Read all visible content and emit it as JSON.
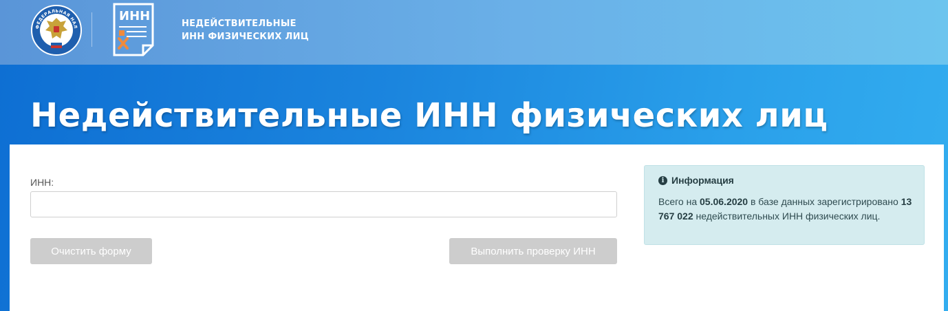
{
  "header": {
    "brand_line1": "НЕДЕЙСТВИТЕЛЬНЫЕ",
    "brand_line2": "ИНН ФИЗИЧЕСКИХ ЛИЦ",
    "emblem_text": "ФЕДЕРАЛЬНАЯ НАЛОГОВАЯ СЛУЖБА",
    "logo_text": "ИНН"
  },
  "page": {
    "title": "Недействительные ИНН физических лиц"
  },
  "form": {
    "inn_label": "ИНН:",
    "inn_value": "",
    "clear_label": "Очистить форму",
    "submit_label": "Выполнить проверку ИНН"
  },
  "info": {
    "icon": "info-circle-icon",
    "heading": "Информация",
    "text_part1": "Всего на ",
    "date": "05.06.2020",
    "text_part2": " в базе данных зарегистрировано ",
    "count": "13 767 022",
    "text_part3": " недействительных ИНН физических лиц."
  },
  "colors": {
    "topbar": "#5a95d8",
    "hero": "#1b85de",
    "button_disabled": "#cdcdcd",
    "info_bg": "#d5ecef"
  }
}
